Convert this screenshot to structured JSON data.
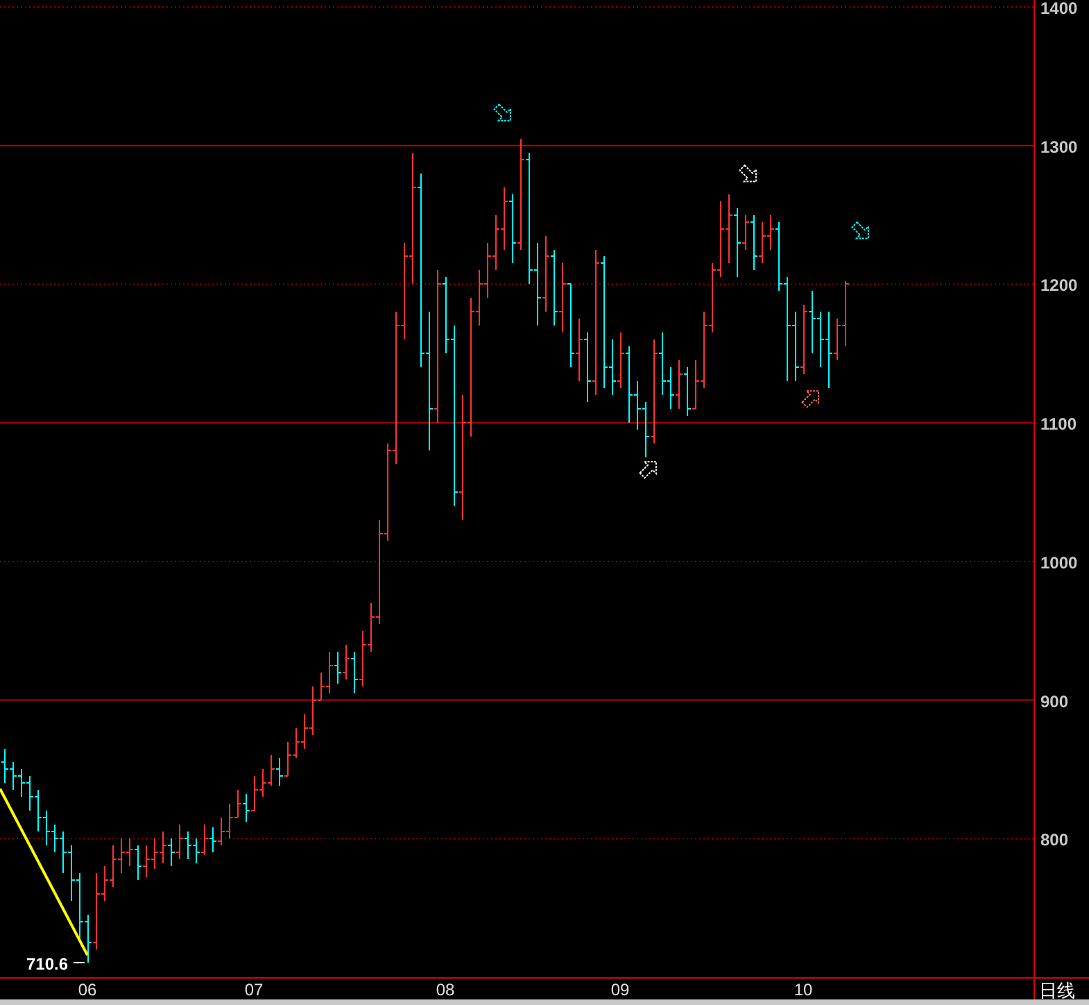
{
  "chart": {
    "price_axis": {
      "labels": [
        "1400",
        "1300",
        "1200",
        "1100",
        "1000",
        "900",
        "800"
      ]
    },
    "time_axis": {
      "labels": [
        "06",
        "07",
        "08",
        "09",
        "10"
      ]
    },
    "low_marker": {
      "text": "710.6"
    },
    "period_label": "日线"
  }
}
